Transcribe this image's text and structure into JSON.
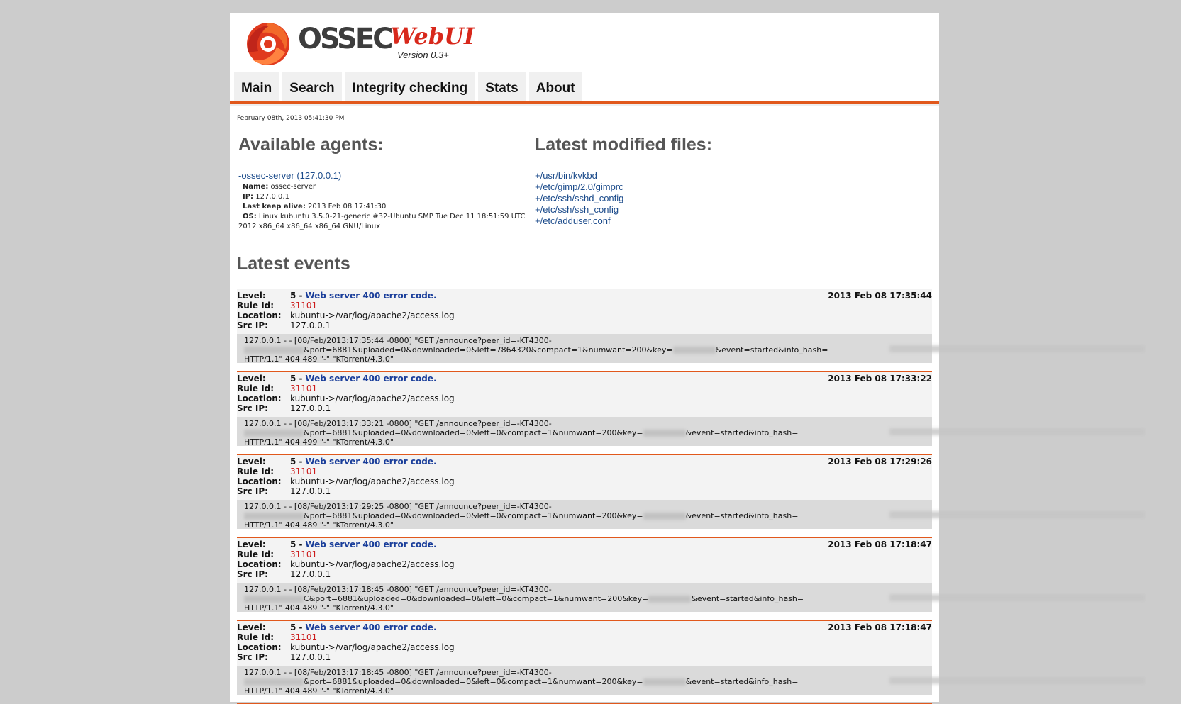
{
  "header": {
    "logo_text": "OSSEC",
    "logo_webui": "WebUI",
    "version": "Version 0.3+"
  },
  "nav": {
    "tabs": [
      {
        "label": "Main"
      },
      {
        "label": "Search"
      },
      {
        "label": "Integrity checking"
      },
      {
        "label": "Stats"
      },
      {
        "label": "About"
      }
    ]
  },
  "datetime": "February 08th, 2013 05:41:30 PM",
  "agents": {
    "title": "Available agents:",
    "link": "-ossec-server (127.0.0.1)",
    "name_label": "Name:",
    "name": "ossec-server",
    "ip_label": "IP:",
    "ip": "127.0.0.1",
    "keepalive_label": "Last keep alive:",
    "keepalive": "2013 Feb 08 17:41:30",
    "os_label": "OS:",
    "os": "Linux kubuntu 3.5.0-21-generic #32-Ubuntu SMP Tue Dec 11 18:51:59 UTC 2012 x86_64 x86_64 x86_64 GNU/Linux"
  },
  "files": {
    "title": "Latest modified files:",
    "items": [
      "+/usr/bin/kvkbd",
      "+/etc/gimp/2.0/gimprc",
      "+/etc/ssh/sshd_config",
      "+/etc/ssh/ssh_config",
      "+/etc/adduser.conf"
    ]
  },
  "events": {
    "title": "Latest events",
    "labels": {
      "level": "Level:",
      "rule": "Rule Id:",
      "location": "Location:",
      "srcip": "Src IP:"
    },
    "items": [
      {
        "level": "5 -",
        "desc": "Web server 400 error code.",
        "time": "2013 Feb 08 17:35:44",
        "rule": "31101",
        "location": "kubuntu->/var/log/apache2/access.log",
        "srcip": "127.0.0.1",
        "log1": "127.0.0.1 - - [08/Feb/2013:17:35:44 -0800] \"GET /announce?peer_id=-KT4300-",
        "log2a": "",
        "log2b": "&port=6881&uploaded=0&downloaded=0&left=7864320&compact=1&numwant=200&key=",
        "log2c": "&event=started&info_hash=",
        "log3": "HTTP/1.1\" 404 489 \"-\" \"KTorrent/4.3.0\""
      },
      {
        "level": "5 -",
        "desc": "Web server 400 error code.",
        "time": "2013 Feb 08 17:33:22",
        "rule": "31101",
        "location": "kubuntu->/var/log/apache2/access.log",
        "srcip": "127.0.0.1",
        "log1": "127.0.0.1 - - [08/Feb/2013:17:33:21 -0800] \"GET /announce?peer_id=-KT4300-",
        "log2a": "",
        "log2b": "&port=6881&uploaded=0&downloaded=0&left=0&compact=1&numwant=200&key=",
        "log2c": "&event=started&info_hash=",
        "log3": "HTTP/1.1\" 404 499 \"-\" \"KTorrent/4.3.0\""
      },
      {
        "level": "5 -",
        "desc": "Web server 400 error code.",
        "time": "2013 Feb 08 17:29:26",
        "rule": "31101",
        "location": "kubuntu->/var/log/apache2/access.log",
        "srcip": "127.0.0.1",
        "log1": "127.0.0.1 - - [08/Feb/2013:17:29:25 -0800] \"GET /announce?peer_id=-KT4300-",
        "log2a": "",
        "log2b": "&port=6881&uploaded=0&downloaded=0&left=0&compact=1&numwant=200&key=",
        "log2c": "&event=started&info_hash=",
        "log3": "HTTP/1.1\" 404 489 \"-\" \"KTorrent/4.3.0\""
      },
      {
        "level": "5 -",
        "desc": "Web server 400 error code.",
        "time": "2013 Feb 08 17:18:47",
        "rule": "31101",
        "location": "kubuntu->/var/log/apache2/access.log",
        "srcip": "127.0.0.1",
        "log1": "127.0.0.1 - - [08/Feb/2013:17:18:45 -0800] \"GET /announce?peer_id=-KT4300-",
        "log2a": "C",
        "log2b": "&port=6881&uploaded=0&downloaded=0&left=0&compact=1&numwant=200&key=",
        "log2c": "&event=started&info_hash=",
        "log3": "HTTP/1.1\" 404 489 \"-\" \"KTorrent/4.3.0\""
      },
      {
        "level": "5 -",
        "desc": "Web server 400 error code.",
        "time": "2013 Feb 08 17:18:47",
        "rule": "31101",
        "location": "kubuntu->/var/log/apache2/access.log",
        "srcip": "127.0.0.1",
        "log1": "127.0.0.1 - - [08/Feb/2013:17:18:45 -0800] \"GET /announce?peer_id=-KT4300-",
        "log2a": "",
        "log2b": "&port=6881&uploaded=0&downloaded=0&left=0&compact=1&numwant=200&key=",
        "log2c": "&event=started&info_hash=",
        "log3": "HTTP/1.1\" 404 489 \"-\" \"KTorrent/4.3.0\""
      }
    ]
  },
  "colors": {
    "accent": "#e1581c",
    "link": "#1a4a8a",
    "rule_id": "#cc1a1a",
    "background": "#cccccc"
  }
}
